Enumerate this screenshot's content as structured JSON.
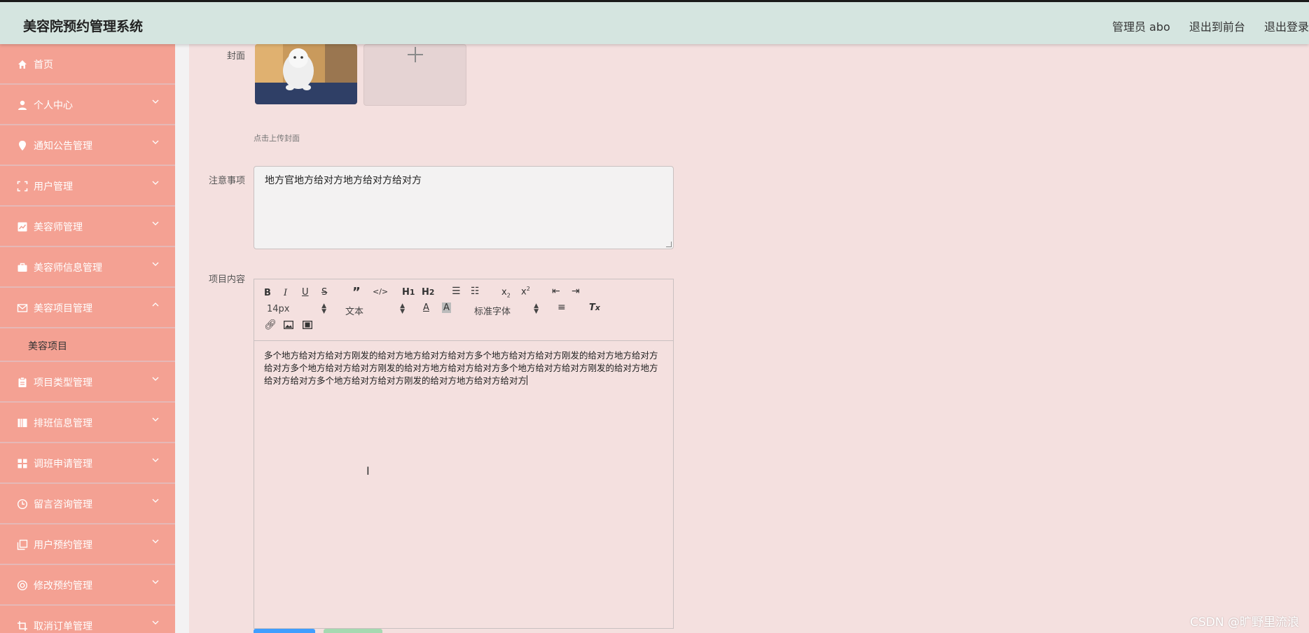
{
  "header": {
    "app_title": "美容院预约管理系统",
    "admin_label": "管理员 abo",
    "back_to_front": "退出到前台",
    "logout": "退出登录"
  },
  "sidebar": {
    "items": [
      {
        "label": "首页",
        "icon": "home-icon"
      },
      {
        "label": "个人中心",
        "icon": "user-icon"
      },
      {
        "label": "通知公告管理",
        "icon": "pin-icon"
      },
      {
        "label": "用户管理",
        "icon": "fullscreen-icon"
      },
      {
        "label": "美容师管理",
        "icon": "chart-icon"
      },
      {
        "label": "美容师信息管理",
        "icon": "briefcase-icon"
      },
      {
        "label": "美容项目管理",
        "icon": "mail-icon",
        "expanded": true
      },
      {
        "label": "美容项目",
        "sub": true
      },
      {
        "label": "项目类型管理",
        "icon": "clipboard-icon"
      },
      {
        "label": "排班信息管理",
        "icon": "book-icon"
      },
      {
        "label": "调班申请管理",
        "icon": "grid-icon"
      },
      {
        "label": "留言咨询管理",
        "icon": "clock-icon"
      },
      {
        "label": "用户预约管理",
        "icon": "copy-icon"
      },
      {
        "label": "修改预约管理",
        "icon": "lifebuoy-icon"
      },
      {
        "label": "取消订单管理",
        "icon": "crop-icon"
      }
    ]
  },
  "form": {
    "cover_label": "封面",
    "cover_hint": "点击上传封面",
    "notes_label": "注意事项",
    "notes_value": "地方官地方给对方地方给对方给对方",
    "content_label": "项目内容",
    "content_value": "多个地方给对方给对方刚发的给对方地方给对方给对方多个地方给对方给对方刚发的给对方地方给对方给对方多个地方给对方给对方刚发的给对方地方给对方给对方多个地方给对方给对方刚发的给对方地方给对方给对方多个地方给对方给对方刚发的给对方地方给对方给对方"
  },
  "editor": {
    "font_size": "14px",
    "block_type": "文本",
    "font_family": "标准字体"
  },
  "watermark": "CSDN @旷野里流浪",
  "colors": {
    "header_bg": "#d5e5e0",
    "sidebar_bg": "#f4a193",
    "main_bg": "#f4e0df"
  }
}
